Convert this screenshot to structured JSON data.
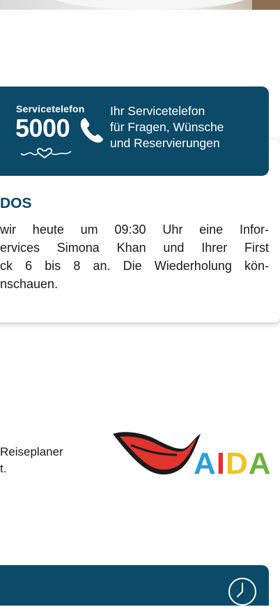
{
  "service_banner": {
    "label": "Servicetelefon",
    "number": "5000",
    "desc_lines": [
      "Ihr Servicetelefon",
      "für Fragen, Wünsche",
      "und Reservierungen"
    ],
    "icons": [
      "phone-icon",
      "heart-line-icon"
    ]
  },
  "news": {
    "title": "DOS",
    "lines": [
      "wir heute um 09:30 Uhr eine Infor-",
      "ervices Simona Khan und Ihrer First",
      "ck 6 bis 8 an. Die Wiederholung kön-",
      "nschauen."
    ]
  },
  "planer": {
    "lines": [
      "Reiseplaner",
      "t."
    ]
  },
  "brand": {
    "letters": [
      "A",
      "I",
      "D",
      "A"
    ],
    "letter_colors": [
      "#2a9fd8",
      "#e0342d",
      "#f2c21b",
      "#6cb33f"
    ],
    "lips_color": "#e0342d"
  },
  "bottom_bar": {
    "icon": "clock-icon"
  },
  "colors": {
    "primary": "#0b4a68",
    "news_title": "#0b4a68"
  }
}
